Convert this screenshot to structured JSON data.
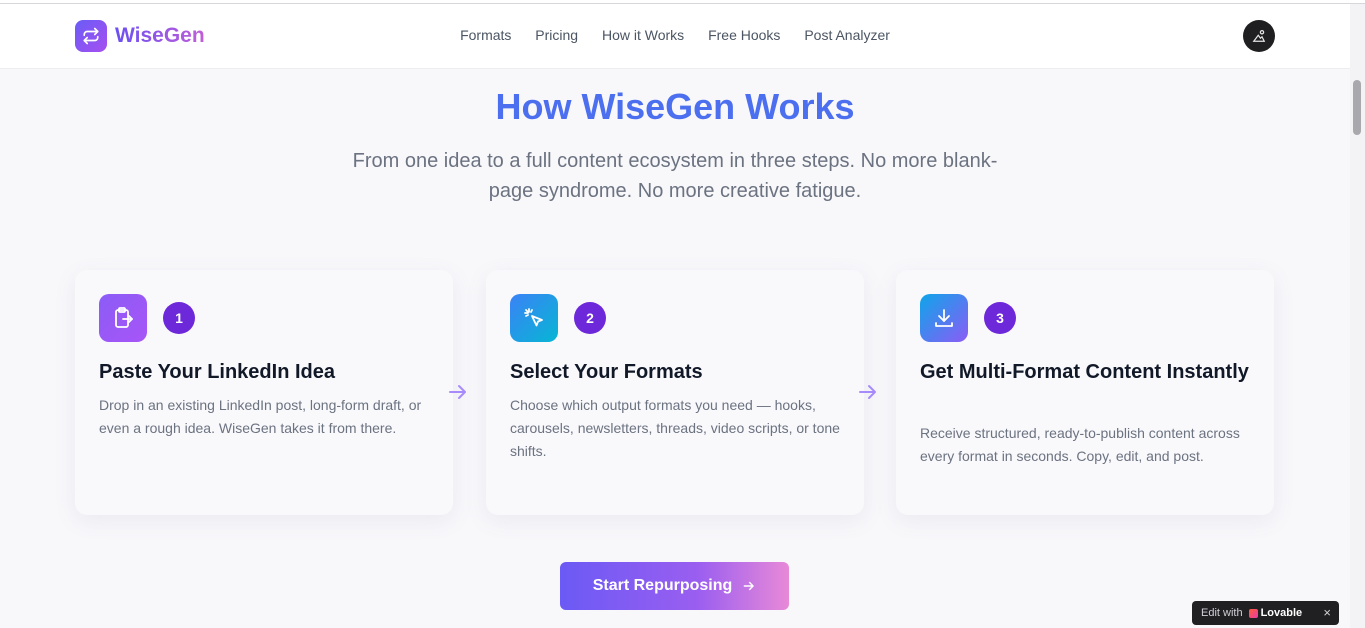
{
  "header": {
    "brand": "WiseGen",
    "nav": [
      "Formats",
      "Pricing",
      "How it Works",
      "Free Hooks",
      "Post Analyzer"
    ]
  },
  "hero": {
    "title": "How WiseGen Works",
    "subtitle": "From one idea to a full content ecosystem in three steps. No more blank-page syndrome. No more creative fatigue."
  },
  "steps": [
    {
      "number": "1",
      "icon": "clipboard-export-icon",
      "title": "Paste Your LinkedIn Idea",
      "description": "Drop in an existing LinkedIn post, long-form draft, or even a rough idea. WiseGen takes it from there."
    },
    {
      "number": "2",
      "icon": "pointer-click-icon",
      "title": "Select Your Formats",
      "description": "Choose which output formats you need — hooks, carousels, newsletters, threads, video scripts, or tone shifts."
    },
    {
      "number": "3",
      "icon": "download-icon",
      "title": "Get Multi-Format Content Instantly",
      "description": "Receive structured, ready-to-publish content across every format in seconds. Copy, edit, and post."
    }
  ],
  "cta": {
    "label": "Start Repurposing"
  },
  "badge": {
    "prefix": "Edit with",
    "brand": "Lovable",
    "close": "×"
  },
  "colors": {
    "accent": "#4c6ff0",
    "step_number": "#6d28d9",
    "icon_gradient_1": [
      "#8b5cf6",
      "#a855f7"
    ],
    "icon_gradient_2": [
      "#3b82f6",
      "#06b6d4"
    ],
    "icon_gradient_3": [
      "#0ea5e9",
      "#8b5cf6"
    ]
  }
}
